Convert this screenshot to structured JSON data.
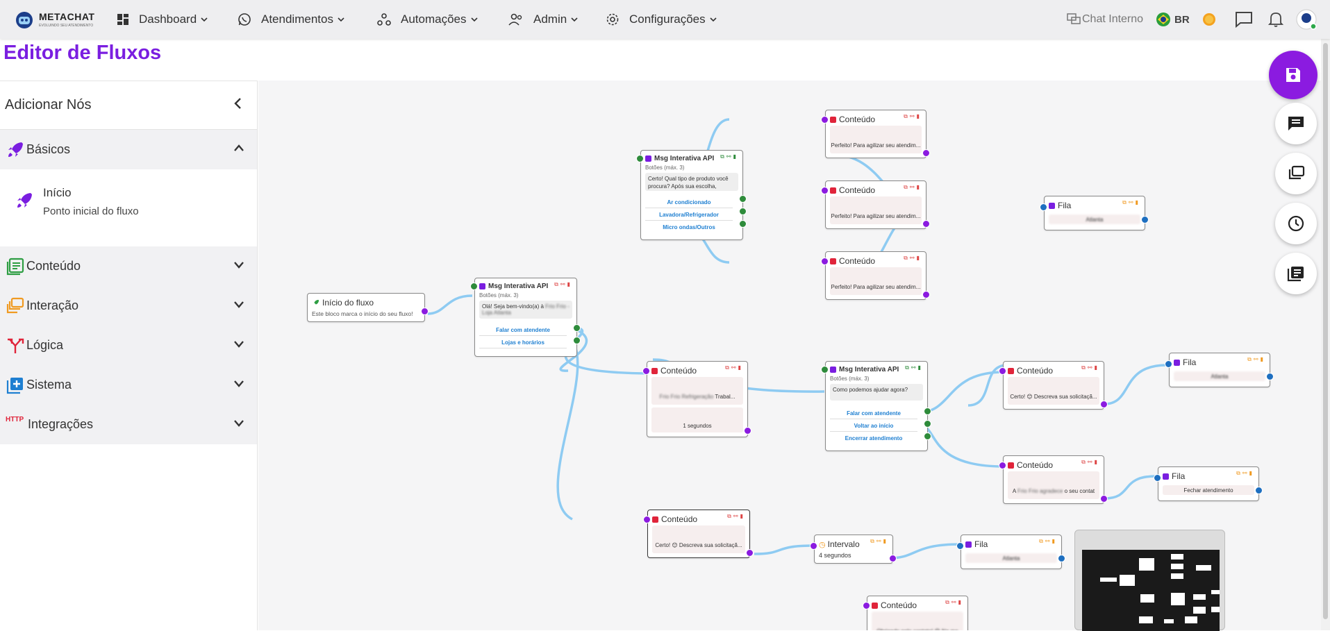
{
  "brand": {
    "name": "METACHAT",
    "tagline": "EVOLUINDO SEU ATENDIMENTO"
  },
  "nav": {
    "dashboard": "Dashboard",
    "atendimentos": "Atendimentos",
    "automacoes": "Automações",
    "admin": "Admin",
    "configuracoes": "Configurações"
  },
  "tools": {
    "chat_interno": "Chat Interno",
    "lang": "BR"
  },
  "page": {
    "title": "Editor de Fluxos"
  },
  "sidebar": {
    "header": "Adicionar Nós",
    "categories": [
      {
        "label": "Básicos"
      },
      {
        "label": "Conteúdo"
      },
      {
        "label": "Interação"
      },
      {
        "label": "Lógica"
      },
      {
        "label": "Sistema"
      },
      {
        "label": "Integrações"
      }
    ],
    "integrations_badge": "HTTP",
    "basic_item": {
      "title": "Início",
      "desc": "Ponto inicial do fluxo"
    }
  },
  "nodes": {
    "start": {
      "title": "Início do fluxo",
      "desc": "Este bloco marca o início do seu fluxo!"
    },
    "msg1": {
      "title": "Msg Interativa API",
      "sub": "Botões (máx. 3)",
      "text": "Olá! Seja bem-vindo(a) à",
      "blur": "Frio Frio - Loja Atlanta",
      "opt1": "Falar com atendente",
      "opt2": "Lojas e horários"
    },
    "msg2": {
      "title": "Msg Interativa API",
      "sub": "Botões (máx. 3)",
      "text": "Certo! Qual tipo de produto você procura? Após sua escolha,",
      "opt1": "Ar condicionado",
      "opt2": "Lavadora/Refrigerador",
      "opt3": "Micro ondas/Outros"
    },
    "msg3": {
      "title": "Msg Interativa API",
      "sub": "Botões (máx. 3)",
      "text": "Como podemos ajudar agora?",
      "opt1": "Falar com atendente",
      "opt2": "Voltar ao início",
      "opt3": "Encerrar atendimento"
    },
    "c1": {
      "title": "Conteúdo",
      "text": "Perfeito! Para agilizar seu atendim..."
    },
    "c2": {
      "title": "Conteúdo",
      "text": "Perfeito! Para agilizar seu atendim..."
    },
    "c3": {
      "title": "Conteúdo",
      "text": "Perfeito! Para agilizar seu atendim..."
    },
    "c4": {
      "title": "Conteúdo",
      "blur": "Frio Frio Refrigeração",
      "text": "Trabal...",
      "timer": "1 segundos"
    },
    "c5": {
      "title": "Conteúdo",
      "text": "Certo! 😊 Descreva sua solicitaçã..."
    },
    "c6": {
      "title": "Conteúdo",
      "pre": "A",
      "blur": "Frio Frio agradece",
      "text": "o seu contat"
    },
    "c7": {
      "title": "Conteúdo",
      "text": "Certo! 😊 Descreva sua solicitaçã..."
    },
    "c8": {
      "title": "Conteúdo",
      "text": "Obrigado pelo contato! 😊 Na me"
    },
    "f1": {
      "title": "Fila",
      "blur": "Atlanta"
    },
    "f2": {
      "title": "Fila",
      "blur": "Atlanta"
    },
    "f3": {
      "title": "Fila",
      "text": "Fechar atendimento"
    },
    "f4": {
      "title": "Fila",
      "blur": "Atlanta"
    },
    "interval": {
      "title": "Intervalo",
      "text": "4 segundos"
    }
  },
  "colors": {
    "accent": "#8b1be0",
    "edge": "#8ecbf2"
  }
}
